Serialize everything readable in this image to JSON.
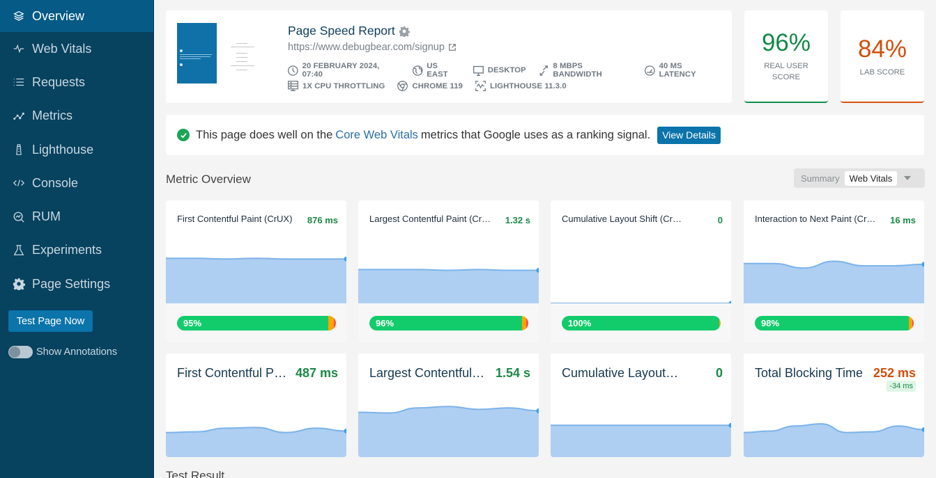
{
  "sidebar": {
    "items": [
      {
        "label": "Overview",
        "icon": "layers-icon",
        "active": true
      },
      {
        "label": "Web Vitals",
        "icon": "pulse-icon"
      },
      {
        "label": "Requests",
        "icon": "list-icon"
      },
      {
        "label": "Metrics",
        "icon": "metrics-chart-icon"
      },
      {
        "label": "Lighthouse",
        "icon": "lighthouse-icon"
      },
      {
        "label": "Console",
        "icon": "code-icon"
      },
      {
        "label": "RUM",
        "icon": "rum-search-icon"
      },
      {
        "label": "Experiments",
        "icon": "flask-icon"
      },
      {
        "label": "Page Settings",
        "icon": "gear-icon"
      }
    ],
    "test_button": "Test Page Now",
    "annotations_label": "Show Annotations",
    "annotations_on": false
  },
  "header": {
    "title": "Page Speed Report",
    "url": "https://www.debugbear.com/signup",
    "meta_row1": [
      {
        "icon": "clock-icon",
        "text": "20 FEBRUARY 2024, 07:40"
      },
      {
        "icon": "globe-icon",
        "text": "US EAST"
      },
      {
        "icon": "desktop-icon",
        "text": "DESKTOP"
      },
      {
        "icon": "bandwidth-icon",
        "text": "8 MBPS BANDWIDTH"
      },
      {
        "icon": "latency-gauge-icon",
        "text": "40 MS LATENCY"
      }
    ],
    "meta_row2": [
      {
        "icon": "cpu-icon",
        "text": "1X CPU THROTTLING"
      },
      {
        "icon": "chrome-icon",
        "text": "CHROME 119"
      },
      {
        "icon": "lighthouse-version-icon",
        "text": "LIGHTHOUSE 11.3.0"
      }
    ]
  },
  "scores": {
    "real_user": {
      "value": "96%",
      "label": "REAL USER SCORE",
      "color": "#118a45"
    },
    "lab": {
      "value": "84%",
      "label": "LAB SCORE",
      "color": "#d14e0a"
    }
  },
  "banner": {
    "text_before": "This page does well on the",
    "link": "Core Web Vitals",
    "text_after": "metrics that Google uses as a ranking signal.",
    "button": "View Details"
  },
  "metric_overview": {
    "title": "Metric Overview",
    "segments": [
      "Summary",
      "Web Vitals"
    ],
    "selected_segment": "Web Vitals"
  },
  "crux_metrics": [
    {
      "name": "First Contentful Paint (CrUX)",
      "value": "876 ms",
      "good_pct": 95,
      "good_label": "95%",
      "ni_pct": 3.5,
      "poor_pct": 1.5,
      "trend": [
        0.6,
        0.6,
        0.59,
        0.6,
        0.59,
        0.59,
        0.59
      ]
    },
    {
      "name": "Largest Contentful Paint (CrUX)",
      "value": "1.32 s",
      "good_pct": 96,
      "good_label": "96%",
      "ni_pct": 2.8,
      "poor_pct": 1.2,
      "trend": [
        0.45,
        0.45,
        0.45,
        0.44,
        0.45,
        0.44,
        0.44
      ]
    },
    {
      "name": "Cumulative Layout Shift (CrUX)",
      "value": "0",
      "good_pct": 99,
      "good_label": "100%",
      "ni_pct": 1.0,
      "poor_pct": 0,
      "trend": [
        0.0,
        0.0,
        0.0,
        0.0,
        0.0,
        0.0,
        0.0
      ]
    },
    {
      "name": "Interaction to Next Paint (CrUX)",
      "value": "16 ms",
      "good_pct": 97,
      "good_label": "98%",
      "ni_pct": 2.0,
      "poor_pct": 1.0,
      "trend": [
        0.53,
        0.53,
        0.47,
        0.56,
        0.5,
        0.5,
        0.52
      ]
    }
  ],
  "lab_metrics": [
    {
      "name": "First Contentful Paint",
      "value": "487 ms",
      "status": "good",
      "trend": [
        0.34,
        0.35,
        0.4,
        0.41,
        0.34,
        0.4,
        0.36
      ]
    },
    {
      "name": "Largest Contentful Paint",
      "value": "1.54 s",
      "status": "good",
      "trend": [
        0.62,
        0.61,
        0.68,
        0.7,
        0.66,
        0.68,
        0.64
      ]
    },
    {
      "name": "Cumulative Layout Shift",
      "value": "0",
      "status": "good",
      "trend": [
        0.44,
        0.44,
        0.44,
        0.44,
        0.44,
        0.44,
        0.44
      ]
    },
    {
      "name": "Total Blocking Time",
      "value": "252 ms",
      "status": "warn",
      "delta": "-34 ms",
      "trend": [
        0.34,
        0.36,
        0.43,
        0.46,
        0.34,
        0.35,
        0.43,
        0.38
      ]
    }
  ],
  "test_result": {
    "title": "Test Result"
  },
  "colors": {
    "sidebar_bg": "#07425f",
    "sidebar_active": "#055a86",
    "accent": "#0b74aa",
    "good": "#12cc6b",
    "needs_improvement": "#ffa400",
    "poor": "#ff4e42",
    "chart_fill": "#aecff2",
    "chart_line": "#7cb3ea"
  }
}
